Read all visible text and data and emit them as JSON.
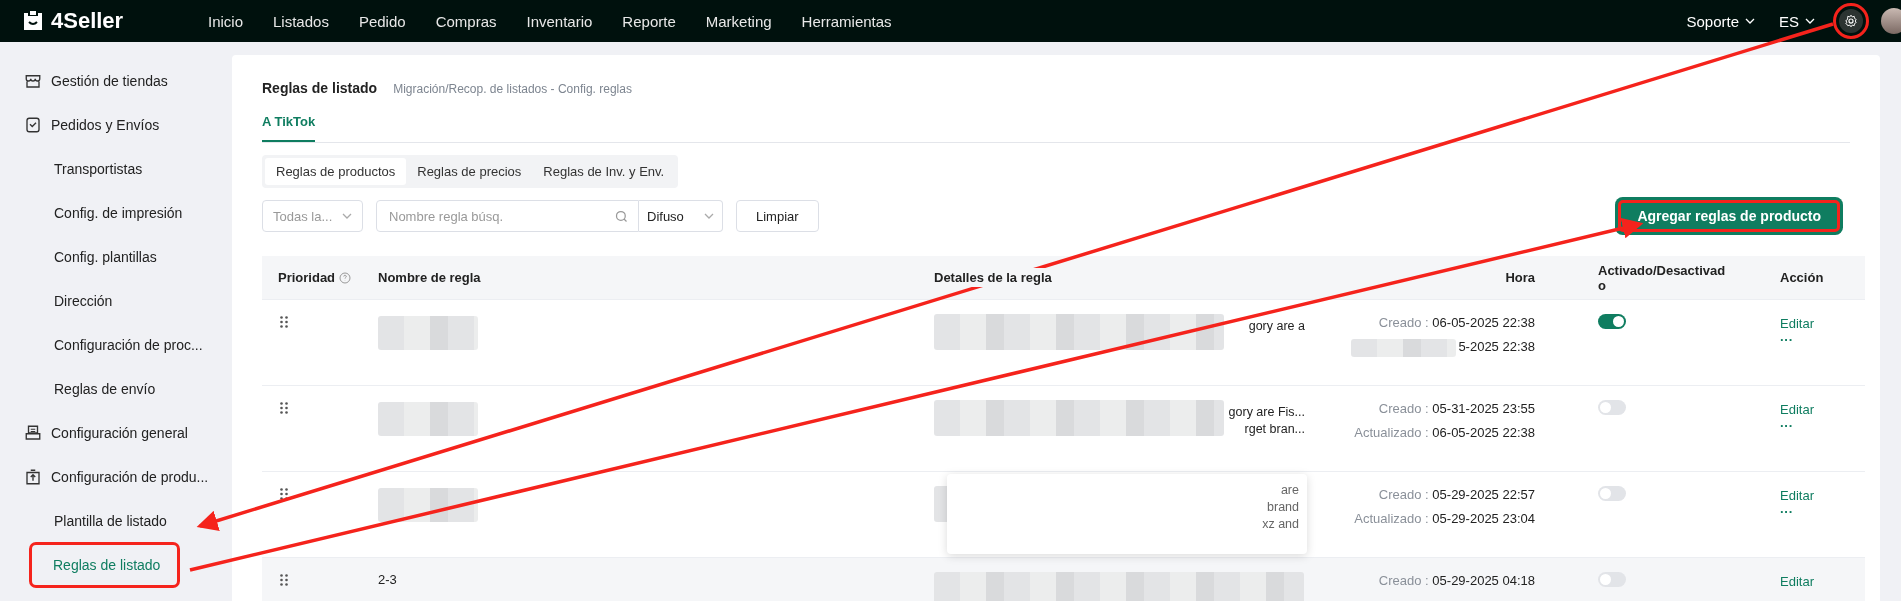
{
  "topbar": {
    "logo": "4Seller",
    "nav": [
      {
        "label": "Inicio"
      },
      {
        "label": "Listados"
      },
      {
        "label": "Pedido"
      },
      {
        "label": "Compras"
      },
      {
        "label": "Inventario"
      },
      {
        "label": "Reporte"
      },
      {
        "label": "Marketing"
      },
      {
        "label": "Herramientas"
      }
    ],
    "menus": [
      {
        "label": "Soporte"
      },
      {
        "label": "ES"
      }
    ],
    "settings_highlighted": true
  },
  "sidebar": {
    "items": [
      {
        "label": "Gestión de tiendas",
        "selected": false
      },
      {
        "label": "Pedidos y Envíos",
        "selected": false,
        "children": [
          {
            "label": "Transportistas",
            "selected": false
          },
          {
            "label": "Config. de impresión",
            "selected": false
          },
          {
            "label": "Config. plantillas",
            "selected": false
          },
          {
            "label": "Dirección",
            "selected": false
          },
          {
            "label": "Configuración de proc...",
            "selected": false
          },
          {
            "label": "Reglas de envío",
            "selected": false
          }
        ]
      },
      {
        "label": "Configuración general",
        "selected": false
      },
      {
        "label": "Configuración de produ...",
        "selected": false,
        "children": [
          {
            "label": "Plantilla de listado",
            "selected": false
          },
          {
            "label": "Reglas de listado",
            "selected": true,
            "highlighted": true
          }
        ]
      }
    ]
  },
  "page": {
    "title": "Reglas de listado",
    "subtitle": "Migración/Recop. de listados - Config. reglas",
    "tabs": [
      {
        "label": "A TikTok",
        "selected": true
      }
    ],
    "segments": [
      {
        "label": "Reglas de productos",
        "selected": true
      },
      {
        "label": "Reglas de precios",
        "selected": false
      },
      {
        "label": "Reglas de Inv. y Env.",
        "selected": false
      }
    ],
    "filters": {
      "store_select": "Todas la...",
      "search_placeholder": "Nombre regla búsq.",
      "match_select": "Difuso",
      "clear_button": "Limpiar"
    },
    "add_button": {
      "label": "Agregar reglas de producto",
      "highlighted": true
    }
  },
  "table": {
    "columns": [
      "Prioridad",
      "Nombre de regla",
      "Detalles de la regla",
      "Hora",
      "Activado/Desactivado",
      "Acción"
    ],
    "rows": [
      {
        "name_redacted": true,
        "details": [
          "gory are a"
        ],
        "details_redacted": true,
        "created_label": "Creado :",
        "created": "06-05-2025 22:38",
        "updated": "5-2025 22:38",
        "updated_redacted": true,
        "enabled": true,
        "action": "Editar",
        "more": "···"
      },
      {
        "name_redacted": true,
        "details": [
          "gory are Fis...",
          "rget bran..."
        ],
        "details_redacted": true,
        "created_label": "Creado :",
        "created": "05-31-2025 23:55",
        "updated_label": "Actualizado :",
        "updated": "06-05-2025 22:38",
        "enabled": false,
        "action": "Editar",
        "more": "···"
      },
      {
        "name_redacted": true,
        "details": [
          "are",
          "brand",
          "xz and"
        ],
        "details_redacted": true,
        "popover": true,
        "created_label": "Creado :",
        "created": "05-29-2025 22:57",
        "updated_label": "Actualizado :",
        "updated": "05-29-2025 23:04",
        "enabled": false,
        "action": "Editar",
        "more": "···"
      },
      {
        "name": "2-3",
        "details": [],
        "details_redacted": true,
        "created_label": "Creado :",
        "created": "05-29-2025 04:18",
        "enabled": false,
        "action": "Editar",
        "hovered": true
      }
    ]
  }
}
